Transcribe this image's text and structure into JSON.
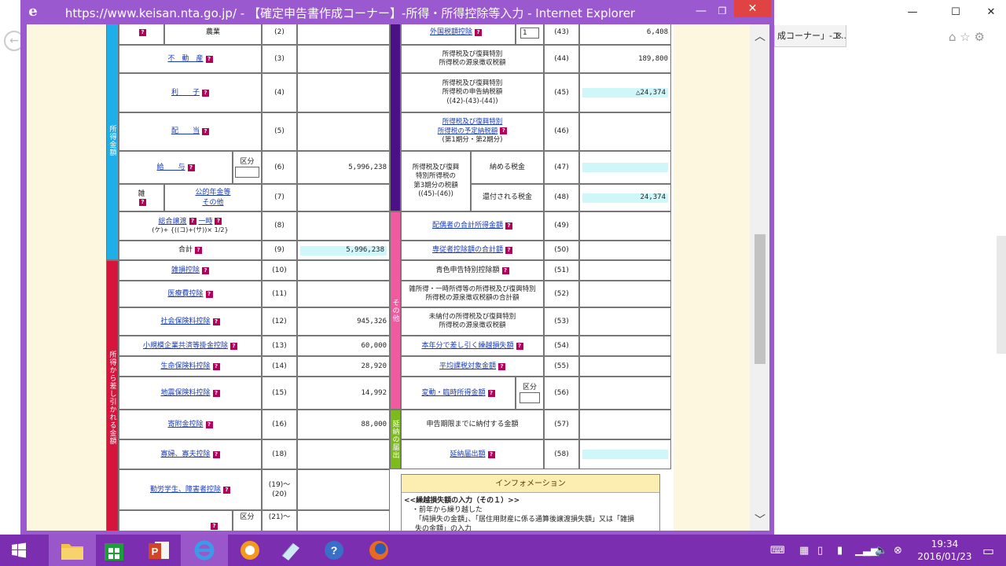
{
  "background_window": {
    "tab_label": "成コーナー」-エ...",
    "tab_close": "✕"
  },
  "window": {
    "title": "https://www.keisan.nta.go.jp/ - 【確定申告書作成コーナー】-所得・所得控除等入力 - Internet Explorer"
  },
  "left_bars": {
    "income": "所得金額",
    "deductions": "所得から差し引かれる金額"
  },
  "middle_bars": {
    "other": "その他",
    "extension": "延納の届出"
  },
  "labels": {
    "q": "?",
    "kubun": "区分",
    "foreign_box": "1"
  },
  "left_rows": [
    {
      "label": "農業",
      "code": "(2)",
      "value": ""
    },
    {
      "label": "不　動　産",
      "code": "(3)",
      "value": ""
    },
    {
      "label": "利　　子",
      "code": "(4)",
      "value": ""
    },
    {
      "label": "配　　当",
      "code": "(5)",
      "value": ""
    },
    {
      "label": "給　　与",
      "code": "(6)",
      "value": "5,996,238"
    },
    {
      "label": "公的年金等\nその他",
      "prefix": "雑",
      "code": "(7)",
      "value": ""
    },
    {
      "label": "総合譲渡",
      "label2": "一時",
      "sub": "(ケ)+ {((コ)+(サ))× 1/2}",
      "code": "(8)",
      "value": ""
    },
    {
      "label": "合計",
      "code": "(9)",
      "value": "5,996,238"
    },
    {
      "label": "雑損控除",
      "code": "(10)",
      "value": ""
    },
    {
      "label": "医療費控除",
      "code": "(11)",
      "value": ""
    },
    {
      "label": "社会保険料控除",
      "code": "(12)",
      "value": "945,326"
    },
    {
      "label": "小規模企業共済等掛金控除",
      "code": "(13)",
      "value": "60,000"
    },
    {
      "label": "生命保険料控除",
      "code": "(14)",
      "value": "28,920"
    },
    {
      "label": "地震保険料控除",
      "code": "(15)",
      "value": "14,992"
    },
    {
      "label": "寄附金控除",
      "code": "(16)",
      "value": "88,000"
    },
    {
      "label": "寡婦、寡夫控除",
      "code": "(18)",
      "value": ""
    },
    {
      "label": "勤労学生、障害者控除",
      "code": "(19)～\n(20)",
      "value": ""
    },
    {
      "label": "",
      "code": "(21)～",
      "value": ""
    }
  ],
  "right_rows": [
    {
      "label": "外国税額控除",
      "code": "(43)",
      "value": "6,408"
    },
    {
      "label": "所得税及び復興特別\n所得税の源泉徴収税額",
      "code": "(44)",
      "value": "189,800"
    },
    {
      "label": "所得税及び復興特別\n所得税の申告納税額\n((42)-(43)-(44))",
      "code": "(45)",
      "value": "△24,374"
    },
    {
      "label": "所得税及び復興特別\n所得税の予定納税額",
      "sub": "(第1期分・第2期分)",
      "code": "(46)",
      "value": ""
    },
    {
      "label": "所得税及び復興\n特別所得税の\n第3期分の税額\n((45)-(46))",
      "code": "",
      "value": ""
    },
    {
      "label": "納める税金",
      "code": "(47)",
      "value": ""
    },
    {
      "label": "還付される税金",
      "code": "(48)",
      "value": "24,374"
    },
    {
      "label": "配偶者の合計所得金額",
      "code": "(49)",
      "value": ""
    },
    {
      "label": "専従者控除額の合計額",
      "code": "(50)",
      "value": ""
    },
    {
      "label": "青色申告特別控除額",
      "code": "(51)",
      "value": ""
    },
    {
      "label": "雑所得・一時所得等の所得税及び復興特別\n所得税の源泉徴収税額の合計額",
      "code": "(52)",
      "value": ""
    },
    {
      "label": "未納付の所得税及び復興特別\n所得税の源泉徴収税額",
      "code": "(53)",
      "value": ""
    },
    {
      "label": "本年分で差し引く繰越損失額",
      "code": "(54)",
      "value": ""
    },
    {
      "label": "平均課税対象金額",
      "code": "(55)",
      "value": ""
    },
    {
      "label": "変動・臨時所得金額",
      "code": "(56)",
      "value": ""
    },
    {
      "label": "申告期限までに納付する金額",
      "code": "(57)",
      "value": ""
    },
    {
      "label": "延納届出額",
      "code": "(58)",
      "value": ""
    }
  ],
  "info": {
    "header": "インフォメーション",
    "title": "<<繰越損失額の入力（その１）>>",
    "line1": "・前年から繰り越した",
    "line2": "「純損失の金額」、「居住用財産に係る通算後譲渡損失額」又は「雑損",
    "line3": "失の金額」の入力"
  },
  "taskbar": {
    "time": "19:34",
    "date": "2016/01/23"
  },
  "colors": {
    "income_bar": "#1eaee8",
    "deduction_bar": "#d6143c",
    "purple_bar": "#4b0f86",
    "other_bar": "#ef5b9e",
    "ext_bar": "#7dbb1c",
    "highlight": "#cff7f9",
    "window_frame": "#9b59d0",
    "taskbar": "#7b2fb0"
  }
}
